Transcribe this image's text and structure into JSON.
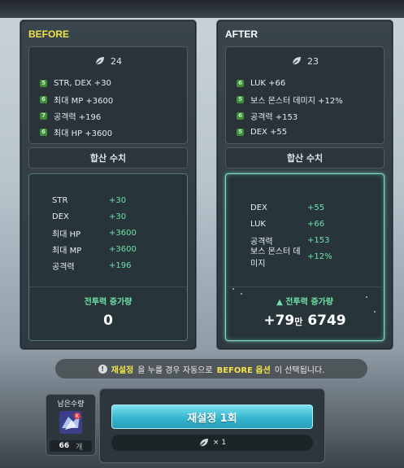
{
  "before": {
    "title": "BEFORE",
    "cube_count": "24",
    "options": [
      {
        "grade": "5",
        "text": "STR, DEX +30"
      },
      {
        "grade": "6",
        "text": "최대 MP +3600"
      },
      {
        "grade": "7",
        "text": "공격력 +196"
      },
      {
        "grade": "6",
        "text": "최대 HP +3600"
      }
    ],
    "sum_title": "합산 수치",
    "stats": [
      {
        "name": "STR",
        "value": "+30"
      },
      {
        "name": "DEX",
        "value": "+30"
      },
      {
        "name": "최대 HP",
        "value": "+3600"
      },
      {
        "name": "최대 MP",
        "value": "+3600"
      },
      {
        "name": "공격력",
        "value": "+196"
      }
    ],
    "cp_label": "전투력 증가량",
    "cp_value": "0"
  },
  "after": {
    "title": "AFTER",
    "cube_count": "23",
    "options": [
      {
        "grade": "6",
        "text": "LUK +66"
      },
      {
        "grade": "5",
        "text": "보스 몬스터 데미지 +12%"
      },
      {
        "grade": "6",
        "text": "공격력 +153"
      },
      {
        "grade": "5",
        "text": "DEX +55"
      }
    ],
    "sum_title": "합산 수치",
    "stats": [
      {
        "name": "DEX",
        "value": "+55"
      },
      {
        "name": "LUK",
        "value": "+66"
      },
      {
        "name": "공격력",
        "value": "+153"
      },
      {
        "name": "보스 몬스터 데미지",
        "value": "+12%"
      }
    ],
    "cp_label": "전투력 증가량",
    "cp_arrow": "▲",
    "cp_value_main": "+79",
    "cp_value_unit": "만",
    "cp_value_rest": "6749"
  },
  "notice": {
    "icon": "info-icon",
    "part1": "재설정",
    "part2": "을 누를 경우 자동으로 ",
    "part3": "BEFORE 옵션",
    "part4": "이 선택됩니다."
  },
  "remaining": {
    "label": "남은수량",
    "count": "66",
    "unit": "개"
  },
  "action": {
    "reset_label": "재설정 1회",
    "cost": "× 1"
  },
  "colors": {
    "accent_yellow": "#f1e24a",
    "stat_green": "#6fe2a6",
    "button_cyan": "#34b6cf"
  }
}
